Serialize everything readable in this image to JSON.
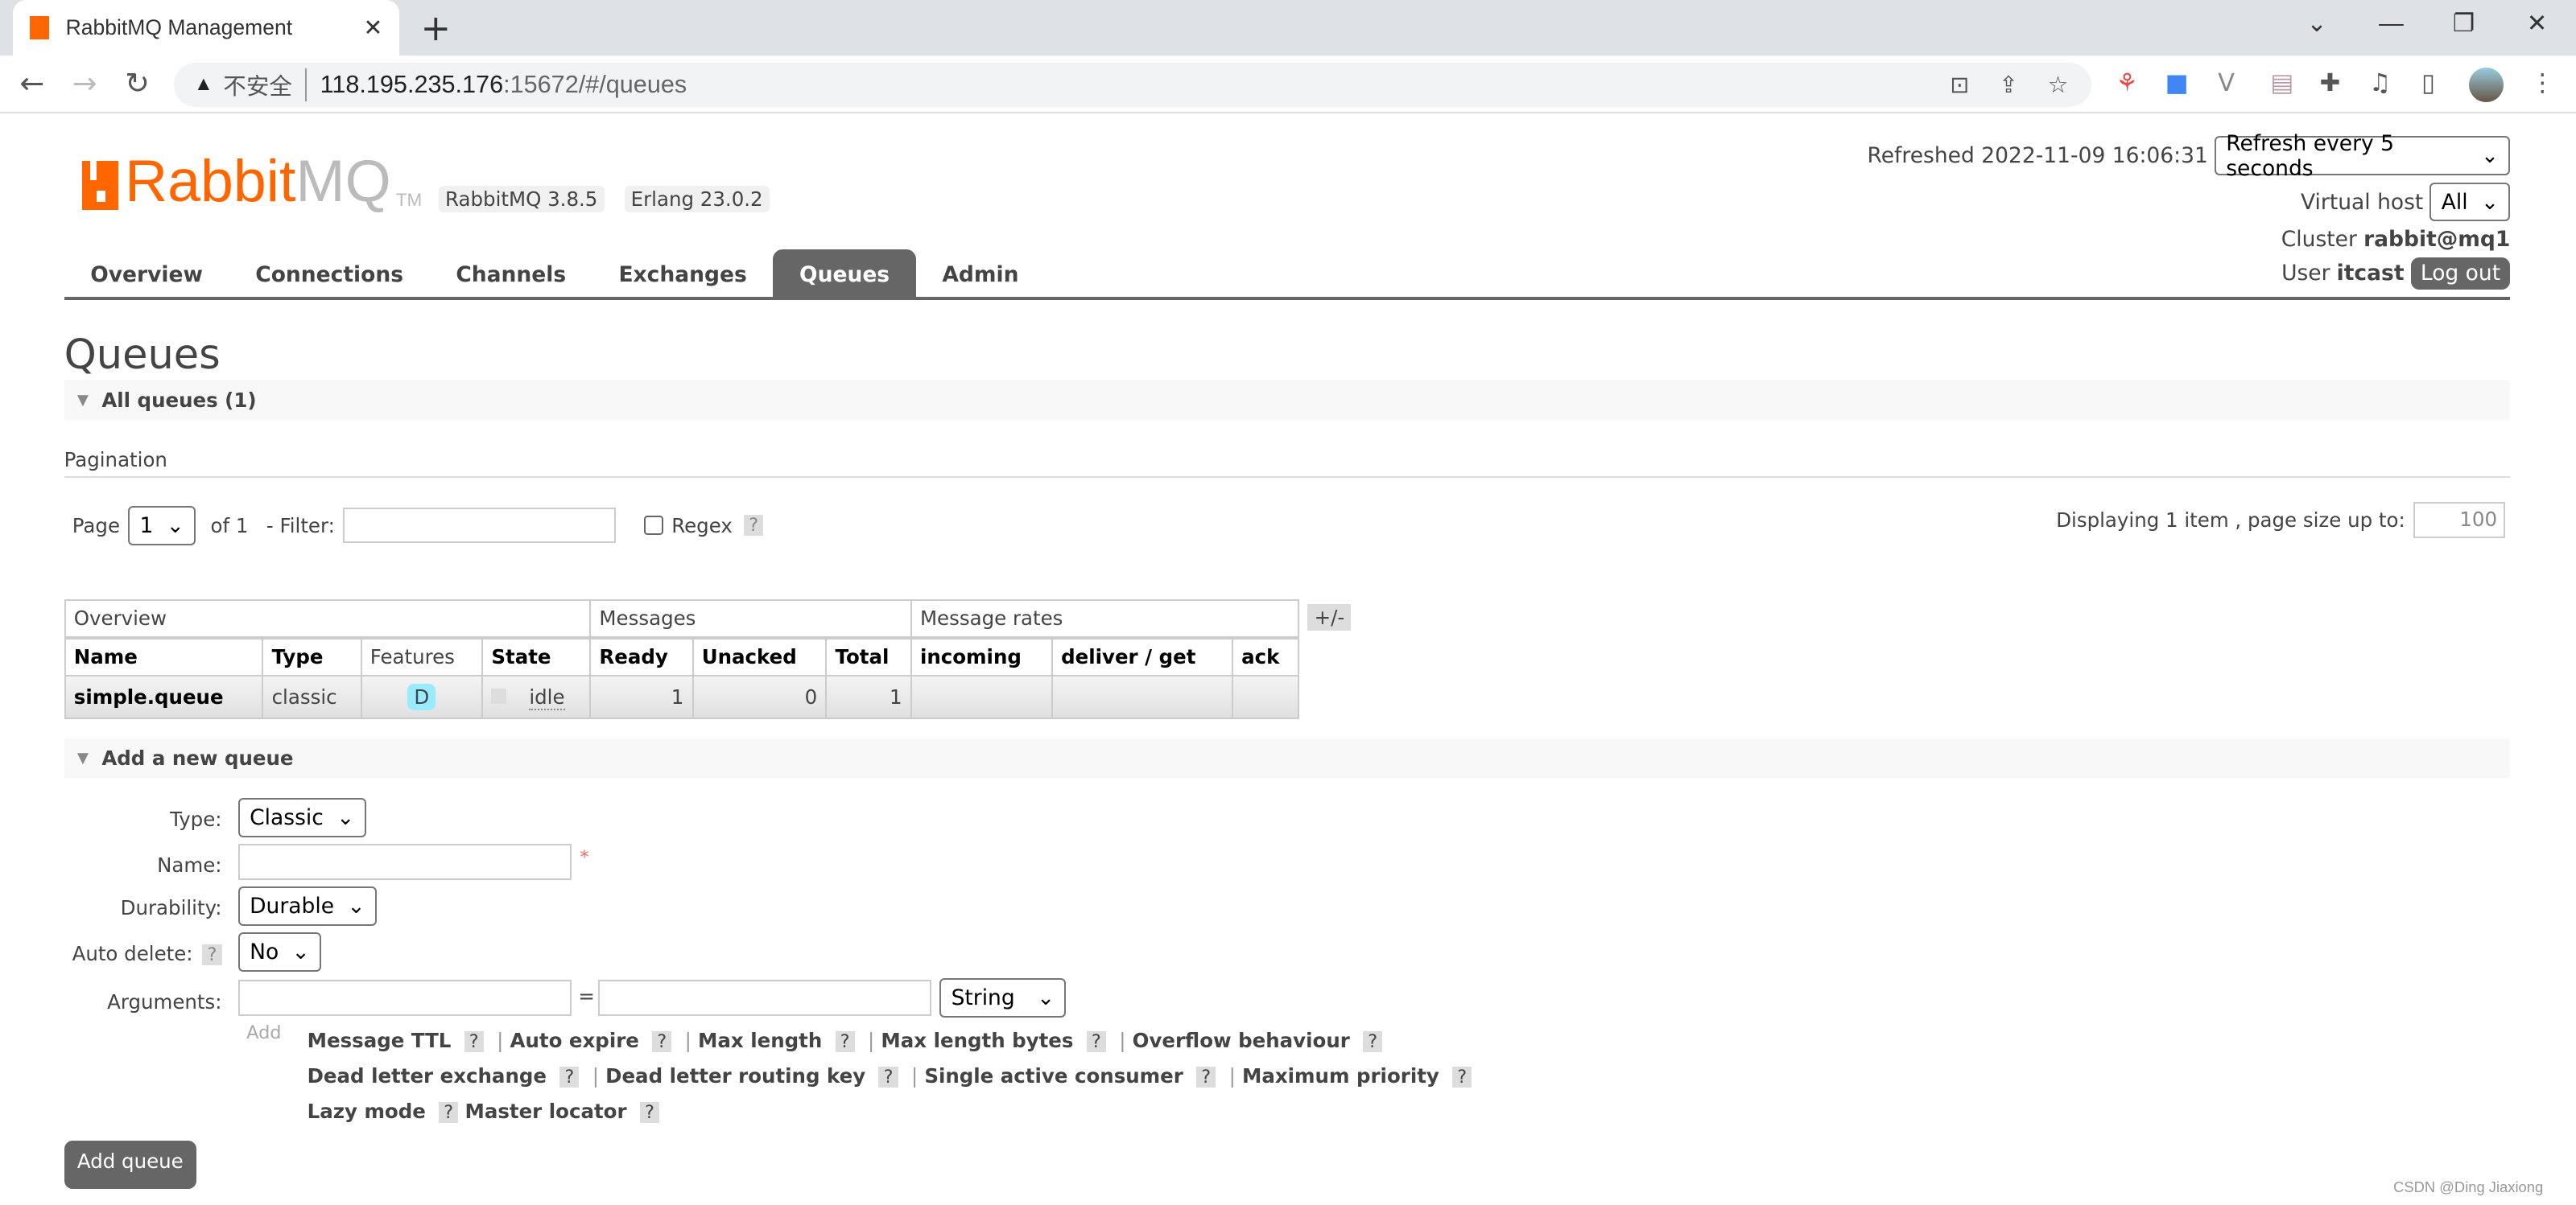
{
  "browser": {
    "tab_title": "RabbitMQ Management",
    "insecure_label": "不安全",
    "url_host": "118.195.235.176",
    "url_rest": ":15672/#/queues"
  },
  "header": {
    "logo_rabbit": "Rabbit",
    "logo_mq": "MQ",
    "logo_tm": "TM",
    "rabbitmq_version": "RabbitMQ 3.8.5",
    "erlang_version": "Erlang 23.0.2",
    "refreshed": "Refreshed 2022-11-09 16:06:31",
    "refresh_select": "Refresh every 5 seconds",
    "vhost_label": "Virtual host",
    "vhost_value": "All",
    "cluster_label": "Cluster",
    "cluster_value": "rabbit@mq1",
    "user_label": "User",
    "user_value": "itcast",
    "logout": "Log out"
  },
  "nav": [
    "Overview",
    "Connections",
    "Channels",
    "Exchanges",
    "Queues",
    "Admin"
  ],
  "active_nav": "Queues",
  "page": {
    "title": "Queues",
    "all_queues": "All queues (1)",
    "pagination": "Pagination",
    "page_label": "Page",
    "page_value": "1",
    "of_label": "of 1",
    "filter_label": "- Filter:",
    "regex_label": "Regex",
    "help": "?",
    "displaying": "Displaying 1 item , page size up to:",
    "page_size": "100",
    "plus_minus": "+/-"
  },
  "table": {
    "groups": [
      "Overview",
      "Messages",
      "Message rates"
    ],
    "columns": [
      "Name",
      "Type",
      "Features",
      "State",
      "Ready",
      "Unacked",
      "Total",
      "incoming",
      "deliver / get",
      "ack"
    ],
    "rows": [
      {
        "name": "simple.queue",
        "type": "classic",
        "features": "D",
        "state": "idle",
        "ready": "1",
        "unacked": "0",
        "total": "1",
        "incoming": "",
        "deliver_get": "",
        "ack": ""
      }
    ]
  },
  "add_queue": {
    "section": "Add a new queue",
    "type_label": "Type:",
    "type_value": "Classic",
    "name_label": "Name:",
    "required": "*",
    "durability_label": "Durability:",
    "durability_value": "Durable",
    "auto_delete_label": "Auto delete:",
    "auto_delete_value": "No",
    "arguments_label": "Arguments:",
    "equals": "=",
    "arg_type": "String",
    "add_label": "Add",
    "arg_rows": [
      [
        "Message TTL",
        "Auto expire",
        "Max length",
        "Max length bytes",
        "Overflow behaviour"
      ],
      [
        "Dead letter exchange",
        "Dead letter routing key",
        "Single active consumer",
        "Maximum priority"
      ],
      [
        "Lazy mode",
        "Master locator"
      ]
    ],
    "submit": "Add queue"
  },
  "watermark": "CSDN @Ding Jiaxiong",
  "colors": {
    "brand": "#ff6600",
    "active_tab": "#666666",
    "feature_badge": "#99ebff"
  }
}
